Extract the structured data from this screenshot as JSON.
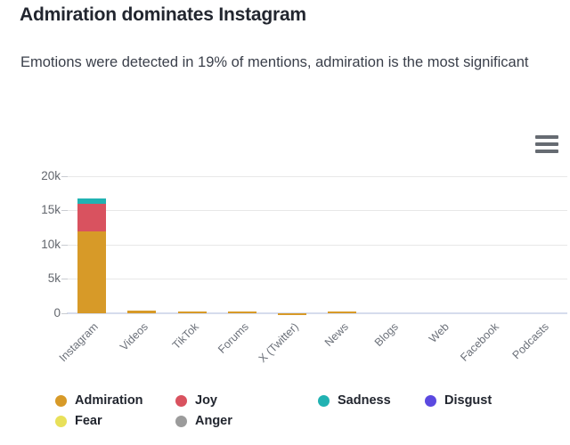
{
  "header": {
    "title": "Admiration dominates Instagram",
    "subtitle": "Emotions were detected in 19% of mentions, admiration is the most significant"
  },
  "toolbar": {
    "menu_label": "Chart context menu",
    "menu_icon": "hamburger-menu-icon"
  },
  "chart_data": {
    "type": "bar",
    "stacked": true,
    "title": "Admiration dominates Instagram",
    "subtitle": "Emotions were detected in 19% of mentions, admiration is the most significant",
    "xlabel": "",
    "ylabel": "",
    "ylim": [
      0,
      20000
    ],
    "ytick_values": [
      0,
      5000,
      10000,
      15000,
      20000
    ],
    "ytick_labels": [
      "0",
      "5k",
      "10k",
      "15k",
      "20k"
    ],
    "grid": true,
    "legend_position": "bottom",
    "categories": [
      "Instagram",
      "Videos",
      "TikTok",
      "Forums",
      "X (Twitter)",
      "News",
      "Blogs",
      "Web",
      "Facebook",
      "Podcasts"
    ],
    "series": [
      {
        "name": "Admiration",
        "color": "#d79a28",
        "values": [
          11900,
          330,
          290,
          270,
          60,
          250,
          0,
          0,
          0,
          0
        ]
      },
      {
        "name": "Joy",
        "color": "#d9525f",
        "values": [
          4050,
          0,
          0,
          0,
          0,
          0,
          0,
          0,
          0,
          0
        ]
      },
      {
        "name": "Sadness",
        "color": "#21b2b2",
        "values": [
          700,
          0,
          0,
          0,
          0,
          0,
          0,
          0,
          0,
          0
        ]
      },
      {
        "name": "Disgust",
        "color": "#5b49e0",
        "values": [
          0,
          0,
          0,
          0,
          0,
          0,
          0,
          0,
          0,
          0
        ]
      },
      {
        "name": "Fear",
        "color": "#e8e05a",
        "values": [
          0,
          0,
          0,
          0,
          0,
          0,
          0,
          0,
          0,
          0
        ]
      },
      {
        "name": "Anger",
        "color": "#9b9b9b",
        "values": [
          0,
          0,
          0,
          0,
          0,
          0,
          0,
          0,
          0,
          0
        ]
      }
    ]
  }
}
